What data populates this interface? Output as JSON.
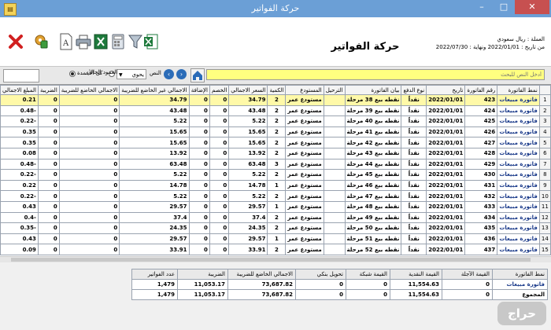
{
  "window": {
    "title": "حركة الفواتير",
    "controls": [
      "–",
      "□",
      "✕"
    ]
  },
  "header": {
    "form_title": "حركة الفواتير",
    "info_lines": [
      "العملة : ريال سعودي",
      "من تاريخ : 2022/01/01 ونهاية : 2022/07/30"
    ]
  },
  "toolbar": {
    "icons": [
      "close-x-icon",
      "tools-icon",
      "pdf-document-icon",
      "printer-icon",
      "excel-icon",
      "calculator-icon",
      "filter-funnel-icon",
      "excel-export-icon"
    ]
  },
  "search": {
    "placeholder": "أدخل النص للبحث",
    "contains_label": "النص",
    "select_value": "يحوي",
    "radio_current_column": "العمود الحالي",
    "radio_all_columns": "كل الأعمدة",
    "all_columns_selected": true
  },
  "table": {
    "columns": [
      "نمط الفاتورة",
      "رقم الفاتورة",
      "تاريخ",
      "نوع الدفع",
      "بيان الفاتورة",
      "الترحيل",
      "المستودع",
      "الكمية",
      "السعر الاجمالي",
      "الخصم",
      "الإضافة",
      "الاجمالي غير الخاضع للضريبة",
      "الاجمالي الخاضع للضريبة",
      "الضريبة",
      "المبلغ الاجمالي"
    ],
    "selected_row": 0,
    "rows": [
      {
        "n": "1",
        "type": "فاتورة مبيعات",
        "num": "423",
        "date": "2022/01/01",
        "pay": "نقداً",
        "desc": "نقطه بيع 38 مرحلة",
        "post": "",
        "store": "مستودع عمر",
        "qty": "2",
        "price": "34.79",
        "disc": "0",
        "add": "0",
        "nontax": "34.79",
        "taxable": "0",
        "tax": "0",
        "total": "0.21"
      },
      {
        "n": "2",
        "type": "فاتورة مبيعات",
        "num": "424",
        "date": "2022/01/01",
        "pay": "نقداً",
        "desc": "نقطه بيع 39 مرحلة",
        "post": "",
        "store": "مستودع عمر",
        "qty": "2",
        "price": "43.48",
        "disc": "0",
        "add": "0",
        "nontax": "43.48",
        "taxable": "0",
        "tax": "0",
        "total": "0.48-"
      },
      {
        "n": "3",
        "type": "فاتورة مبيعات",
        "num": "425",
        "date": "2022/01/01",
        "pay": "نقداً",
        "desc": "نقطه بيع 40 مرحلة",
        "post": "",
        "store": "مستودع عمر",
        "qty": "2",
        "price": "5.22",
        "disc": "0",
        "add": "0",
        "nontax": "5.22",
        "taxable": "0",
        "tax": "0",
        "total": "0.22-"
      },
      {
        "n": "4",
        "type": "فاتورة مبيعات",
        "num": "426",
        "date": "2022/01/01",
        "pay": "نقداً",
        "desc": "نقطه بيع 41 مرحلة",
        "post": "",
        "store": "مستودع عمر",
        "qty": "2",
        "price": "15.65",
        "disc": "0",
        "add": "0",
        "nontax": "15.65",
        "taxable": "0",
        "tax": "0",
        "total": "0.35"
      },
      {
        "n": "5",
        "type": "فاتورة مبيعات",
        "num": "427",
        "date": "2022/01/01",
        "pay": "نقداً",
        "desc": "نقطه بيع 42 مرحلة",
        "post": "",
        "store": "مستودع عمر",
        "qty": "2",
        "price": "15.65",
        "disc": "0",
        "add": "0",
        "nontax": "15.65",
        "taxable": "0",
        "tax": "0",
        "total": "0.35"
      },
      {
        "n": "6",
        "type": "فاتورة مبيعات",
        "num": "428",
        "date": "2022/01/01",
        "pay": "نقداً",
        "desc": "نقطه بيع 43 مرحلة",
        "post": "",
        "store": "مستودع عمر",
        "qty": "2",
        "price": "13.92",
        "disc": "0",
        "add": "0",
        "nontax": "13.92",
        "taxable": "0",
        "tax": "0",
        "total": "0.08"
      },
      {
        "n": "7",
        "type": "فاتورة مبيعات",
        "num": "429",
        "date": "2022/01/01",
        "pay": "نقداً",
        "desc": "نقطه بيع 44 مرحلة",
        "post": "",
        "store": "مستودع عمر",
        "qty": "3",
        "price": "63.48",
        "disc": "0",
        "add": "0",
        "nontax": "63.48",
        "taxable": "0",
        "tax": "0",
        "total": "0.48-"
      },
      {
        "n": "8",
        "type": "فاتورة مبيعات",
        "num": "430",
        "date": "2022/01/01",
        "pay": "نقداً",
        "desc": "نقطه بيع 45 مرحلة",
        "post": "",
        "store": "مستودع عمر",
        "qty": "2",
        "price": "5.22",
        "disc": "0",
        "add": "0",
        "nontax": "5.22",
        "taxable": "0",
        "tax": "0",
        "total": "0.22-"
      },
      {
        "n": "9",
        "type": "فاتورة مبيعات",
        "num": "431",
        "date": "2022/01/01",
        "pay": "نقداً",
        "desc": "نقطه بيع 46 مرحلة",
        "post": "",
        "store": "مستودع عمر",
        "qty": "1",
        "price": "14.78",
        "disc": "0",
        "add": "0",
        "nontax": "14.78",
        "taxable": "0",
        "tax": "0",
        "total": "0.22"
      },
      {
        "n": "10",
        "type": "فاتورة مبيعات",
        "num": "432",
        "date": "2022/01/01",
        "pay": "نقداً",
        "desc": "نقطه بيع 47 مرحلة",
        "post": "",
        "store": "مستودع عمر",
        "qty": "2",
        "price": "5.22",
        "disc": "0",
        "add": "0",
        "nontax": "5.22",
        "taxable": "0",
        "tax": "0",
        "total": "0.22-"
      },
      {
        "n": "11",
        "type": "فاتورة مبيعات",
        "num": "433",
        "date": "2022/01/01",
        "pay": "نقداً",
        "desc": "نقطه بيع 48 مرحلة",
        "post": "",
        "store": "مستودع عمر",
        "qty": "1",
        "price": "29.57",
        "disc": "0",
        "add": "0",
        "nontax": "29.57",
        "taxable": "0",
        "tax": "0",
        "total": "0.43"
      },
      {
        "n": "12",
        "type": "فاتورة مبيعات",
        "num": "434",
        "date": "2022/01/01",
        "pay": "نقداً",
        "desc": "نقطه بيع 49 مرحلة",
        "post": "",
        "store": "مستودع عمر",
        "qty": "2",
        "price": "37.4",
        "disc": "0",
        "add": "0",
        "nontax": "37.4",
        "taxable": "0",
        "tax": "0",
        "total": "0.4-"
      },
      {
        "n": "13",
        "type": "فاتورة مبيعات",
        "num": "435",
        "date": "2022/01/01",
        "pay": "نقداً",
        "desc": "نقطه بيع 50 مرحلة",
        "post": "",
        "store": "مستودع عمر",
        "qty": "2",
        "price": "24.35",
        "disc": "0",
        "add": "0",
        "nontax": "24.35",
        "taxable": "0",
        "tax": "0",
        "total": "0.35-"
      },
      {
        "n": "14",
        "type": "فاتورة مبيعات",
        "num": "436",
        "date": "2022/01/01",
        "pay": "نقداً",
        "desc": "نقطه بيع 51 مرحلة",
        "post": "",
        "store": "مستودع عمر",
        "qty": "1",
        "price": "29.57",
        "disc": "0",
        "add": "0",
        "nontax": "29.57",
        "taxable": "0",
        "tax": "0",
        "total": "0.43"
      },
      {
        "n": "15",
        "type": "فاتورة مبيعات",
        "num": "437",
        "date": "2022/01/01",
        "pay": "نقداً",
        "desc": "نقطه بيع 52 مرحلة",
        "post": "",
        "store": "مستودع عمر",
        "qty": "2",
        "price": "33.91",
        "disc": "0",
        "add": "0",
        "nontax": "33.91",
        "taxable": "0",
        "tax": "0",
        "total": "0.09"
      }
    ]
  },
  "summary": {
    "columns": [
      "نمط الفاتورة",
      "القيمة الآجلة",
      "القيمة النقدية",
      "القيمة شبكة",
      "تحويل بنكي",
      "الاجمالي الخاضع للضريبة",
      "الضريبة",
      "عدد الفواتير"
    ],
    "rows": [
      {
        "label": "فاتورة مبيعات",
        "deferred": "0",
        "cash": "11,554.63",
        "network": "0",
        "transfer": "0",
        "taxable": "73,687.82",
        "tax": "11,053.17",
        "count": "1,479"
      },
      {
        "label": "المجموع",
        "deferred": "0",
        "cash": "11,554.63",
        "network": "0",
        "transfer": "0",
        "taxable": "73,687.82",
        "tax": "11,053.17",
        "count": "1,479"
      }
    ]
  },
  "watermark": "حراج"
}
